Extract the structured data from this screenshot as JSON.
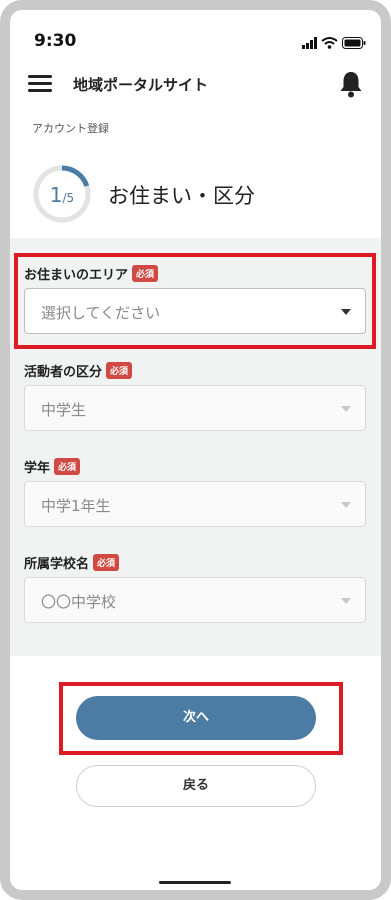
{
  "status_bar": {
    "time": "9:30",
    "icons": [
      "signal-icon",
      "wifi-icon",
      "battery-icon"
    ]
  },
  "app_bar": {
    "title": "地域ポータルサイト",
    "menu_icon": "hamburger-menu-icon",
    "notification_icon": "bell-icon"
  },
  "page": {
    "subtitle": "アカウント登録",
    "step_current": "1",
    "step_total": "/5",
    "step_title": "お住まい・区分",
    "progress_fraction": 0.2
  },
  "form": {
    "required_badge": "必須",
    "fields": [
      {
        "label": "お住まいのエリア",
        "value": "選択してください",
        "active": true
      },
      {
        "label": "活動者の区分",
        "value": "中学生",
        "active": false
      },
      {
        "label": "学年",
        "value": "中学1年生",
        "active": false
      },
      {
        "label": "所属学校名",
        "value": "〇〇中学校",
        "active": false
      }
    ]
  },
  "actions": {
    "next_label": "次へ",
    "back_label": "戻る"
  },
  "colors": {
    "accent": "#4c7ca4",
    "badge": "#d04a43",
    "highlight": "#dd1b24",
    "form_bg": "#f1f2f2"
  }
}
